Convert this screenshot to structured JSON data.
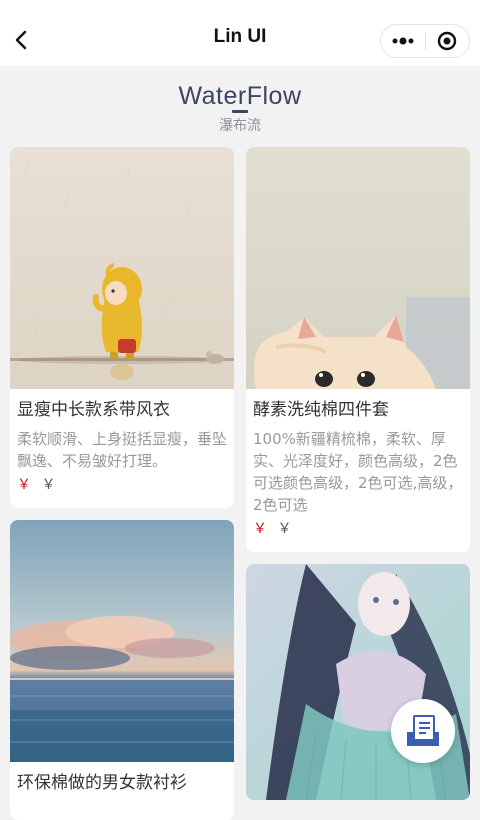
{
  "navbar": {
    "title": "Lin UI",
    "back_icon": "chevron-left-icon",
    "menu_icon": "more-dots-icon",
    "close_icon": "target-circle-icon"
  },
  "header": {
    "title": "WaterFlow",
    "subtitle": "瀑布流"
  },
  "products": [
    {
      "title": "显瘦中长款系带风衣",
      "desc": "柔软顺滑、上身挺括显瘦，垂坠飘逸、不易皱好打理。",
      "price_symbol": "￥",
      "orig_symbol": "￥",
      "image": "girl-in-yellow-raincoat"
    },
    {
      "title": "酵素洗纯棉四件套",
      "desc": "100%新疆精梳棉，柔软、厚实、光泽度好，颜色高级，2色可选颜色高级，2色可选,高级，2色可选",
      "price_symbol": "￥",
      "orig_symbol": "￥",
      "image": "white-kitten"
    },
    {
      "title": "环保棉做的男女款衬衫",
      "image": "sea-clouds-sunset"
    },
    {
      "image": "anime-girl-illustration"
    }
  ],
  "fab": {
    "icon": "book-rack-icon"
  },
  "colors": {
    "accent": "#3b4560",
    "price": "#c01a1a",
    "fab_icon": "#3a5fb0"
  }
}
